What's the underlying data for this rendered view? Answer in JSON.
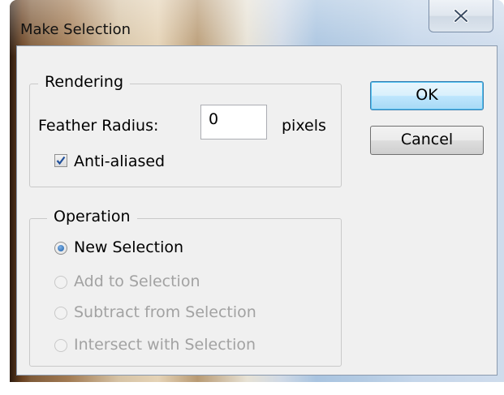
{
  "window": {
    "title": "Make Selection"
  },
  "rendering": {
    "group_label": "Rendering",
    "feather_label": "Feather Radius:",
    "feather_value": "0",
    "feather_unit": "pixels",
    "anti_aliased_label": "Anti-aliased",
    "anti_aliased_checked": true
  },
  "operation": {
    "group_label": "Operation",
    "options": [
      {
        "label": "New Selection",
        "selected": true,
        "enabled": true
      },
      {
        "label": "Add to Selection",
        "selected": false,
        "enabled": false
      },
      {
        "label": "Subtract from Selection",
        "selected": false,
        "enabled": false
      },
      {
        "label": "Intersect with Selection",
        "selected": false,
        "enabled": false
      }
    ]
  },
  "buttons": {
    "ok": "OK",
    "cancel": "Cancel"
  },
  "icons": {
    "close": "close-icon",
    "check": "checkmark-icon"
  },
  "colors": {
    "accent": "#3c7fb1",
    "disabled_text": "#a2a2a2",
    "dialog_bg": "#f0f0f0"
  }
}
